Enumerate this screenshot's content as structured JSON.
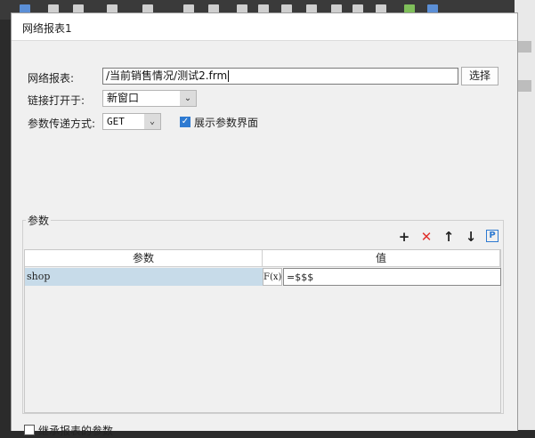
{
  "dialog": {
    "title": "网络报表1"
  },
  "form": {
    "report_label": "网络报表:",
    "report_path": "/当前销售情况/测试2.frm",
    "choose_button": "选择",
    "link_open_label": "链接打开于:",
    "link_open_value": "新窗口",
    "param_method_label": "参数传递方式:",
    "param_method_value": "GET",
    "show_params_label": "展示参数界面"
  },
  "params": {
    "group_title": "参数",
    "columns": [
      "参数",
      "值"
    ],
    "rows": [
      {
        "name": "shop",
        "formula_icon": "F(x)",
        "value": "=$$$"
      }
    ],
    "toolbar_icons": [
      "add-icon",
      "delete-icon",
      "move-up-icon",
      "move-down-icon",
      "param-p-icon"
    ],
    "param_button_label": "P"
  },
  "footer": {
    "inherit_label": "继承报表的参数"
  },
  "colors": {
    "accent": "#2e7ad1",
    "delete": "#e0312c",
    "selected_row": "#c7dbe9"
  }
}
